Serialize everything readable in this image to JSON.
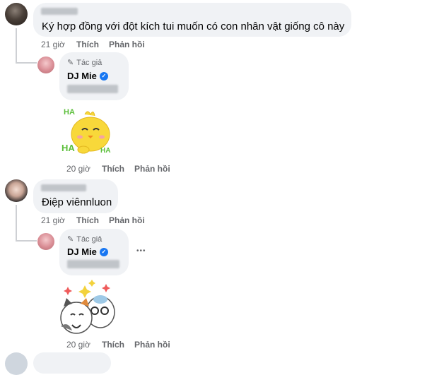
{
  "comments": [
    {
      "body": "Ký hợp đồng với đột kích tui muốn có con nhân vật giống cô này",
      "time": "21 giờ",
      "like": "Thích",
      "reply": "Phản hồi"
    },
    {
      "author_badge": "Tác giả",
      "name": "DJ Mie",
      "sticker_text_top": "HA",
      "sticker_text_left": "HA",
      "sticker_text_right": "HA",
      "time": "20 giờ",
      "like": "Thích",
      "reply": "Phản hồi"
    },
    {
      "body": "Điệp viênnluon",
      "time": "21 giờ",
      "like": "Thích",
      "reply": "Phản hồi"
    },
    {
      "author_badge": "Tác giả",
      "name": "DJ Mie",
      "more": "•••",
      "time": "20 giờ",
      "like": "Thích",
      "reply": "Phản hồi"
    }
  ],
  "colors": {
    "bubble": "#f0f2f5",
    "meta": "#65676b",
    "verified": "#1877f2"
  }
}
